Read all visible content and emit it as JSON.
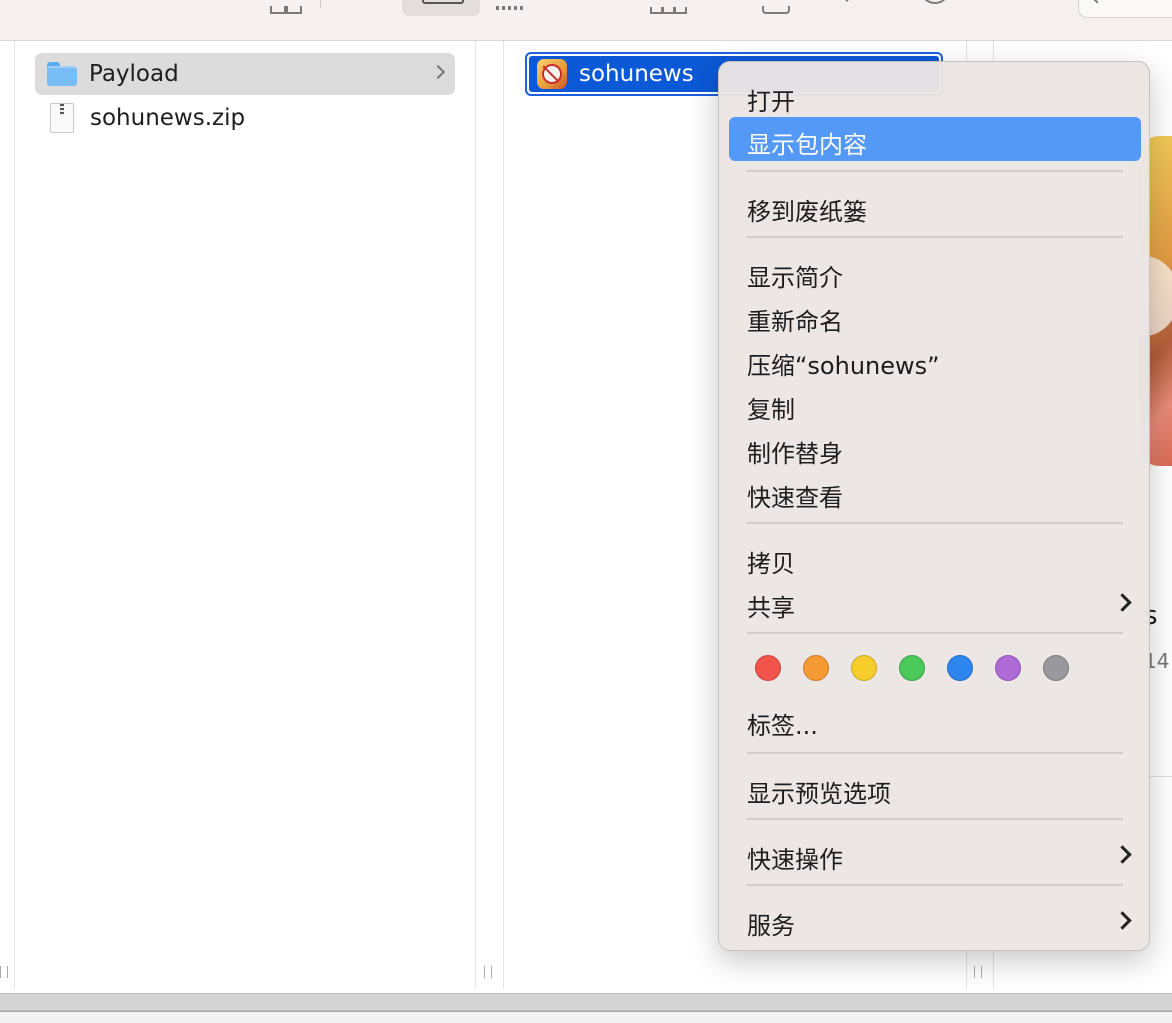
{
  "column1": {
    "items": [
      {
        "label": "Payload"
      },
      {
        "label": "sohunews.zip"
      }
    ]
  },
  "column2": {
    "selected_item": {
      "label": "sohunews"
    }
  },
  "preview": {
    "title_fragment": "s",
    "meta_fragment": "14"
  },
  "context_menu": {
    "groups": [
      [
        {
          "label": "打开"
        },
        {
          "label": "显示包内容",
          "highlighted": true
        }
      ],
      [
        {
          "label": "移到废纸篓"
        }
      ],
      [
        {
          "label": "显示简介"
        },
        {
          "label": "重新命名"
        },
        {
          "label": "压缩“sohunews”"
        },
        {
          "label": "复制"
        },
        {
          "label": "制作替身"
        },
        {
          "label": "快速查看"
        }
      ],
      [
        {
          "label": "拷贝"
        },
        {
          "label": "共享",
          "submenu": true
        }
      ],
      [
        {
          "label": "标签..."
        }
      ],
      [
        {
          "label": "显示预览选项"
        }
      ],
      [
        {
          "label": "快速操作",
          "submenu": true
        }
      ],
      [
        {
          "label": "服务",
          "submenu": true
        }
      ]
    ],
    "tag_colors": [
      {
        "name": "red",
        "color": "#f2534b"
      },
      {
        "name": "orange",
        "color": "#f59a32"
      },
      {
        "name": "yellow",
        "color": "#f8ce2c"
      },
      {
        "name": "green",
        "color": "#4bc95a"
      },
      {
        "name": "blue",
        "color": "#2d86f0"
      },
      {
        "name": "purple",
        "color": "#b06ad6"
      },
      {
        "name": "gray",
        "color": "#98989d"
      }
    ]
  }
}
